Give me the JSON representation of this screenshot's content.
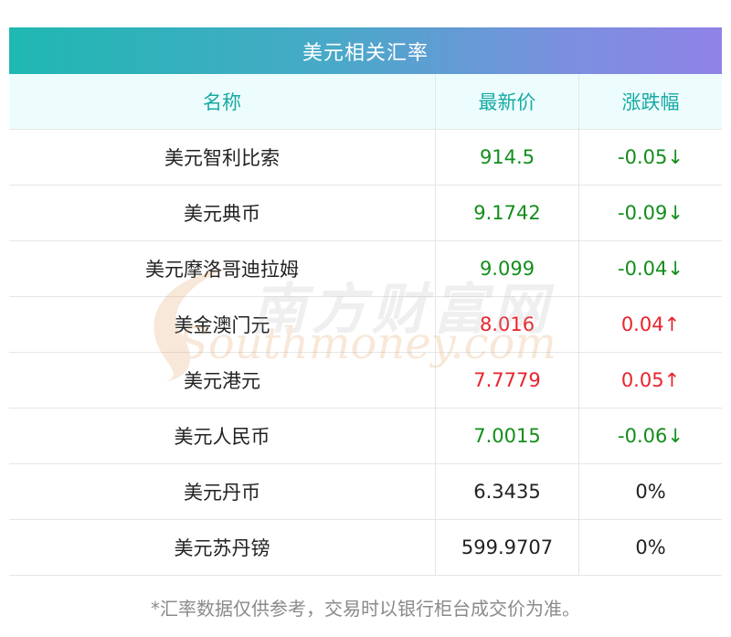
{
  "table_title": "美元相关汇率",
  "columns": [
    "名称",
    "最新价",
    "涨跌幅"
  ],
  "rows": [
    {
      "name": "美元智利比索",
      "price": "914.5",
      "change": "-0.05↓",
      "trend": "down"
    },
    {
      "name": "美元典币",
      "price": "9.1742",
      "change": "-0.09↓",
      "trend": "down"
    },
    {
      "name": "美元摩洛哥迪拉姆",
      "price": "9.099",
      "change": "-0.04↓",
      "trend": "down"
    },
    {
      "name": "美金澳门元",
      "price": "8.016",
      "change": "0.04↑",
      "trend": "up"
    },
    {
      "name": "美元港元",
      "price": "7.7779",
      "change": "0.05↑",
      "trend": "up"
    },
    {
      "name": "美元人民币",
      "price": "7.0015",
      "change": "-0.06↓",
      "trend": "down"
    },
    {
      "name": "美元丹币",
      "price": "6.3435",
      "change": "0%",
      "trend": "flat"
    },
    {
      "name": "美元苏丹镑",
      "price": "599.9707",
      "change": "0%",
      "trend": "flat"
    }
  ],
  "footnote": "*汇率数据仅供参考，交易时以银行柜台成交价为准。",
  "watermark": {
    "cn": "南方财富网",
    "en": "Southmoney.com"
  },
  "colors": {
    "up": "#e8232c",
    "down": "#128e1a",
    "header_text": "#17a9a3"
  }
}
